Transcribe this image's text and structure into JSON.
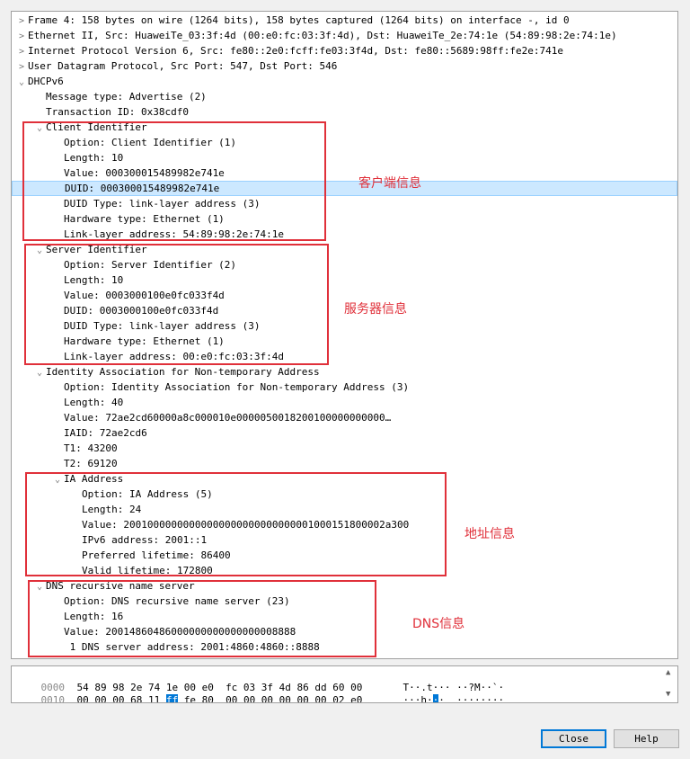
{
  "tree": {
    "rows": [
      {
        "arrow": ">",
        "text": "Frame 4: 158 bytes on wire (1264 bits), 158 bytes captured (1264 bits) on interface -, id 0"
      },
      {
        "arrow": ">",
        "text": "Ethernet II, Src: HuaweiTe_03:3f:4d (00:e0:fc:03:3f:4d), Dst: HuaweiTe_2e:74:1e (54:89:98:2e:74:1e)"
      },
      {
        "arrow": ">",
        "text": "Internet Protocol Version 6, Src: fe80::2e0:fcff:fe03:3f4d, Dst: fe80::5689:98ff:fe2e:741e"
      },
      {
        "arrow": ">",
        "text": "User Datagram Protocol, Src Port: 547, Dst Port: 546"
      },
      {
        "arrow": "⌄",
        "text": "DHCPv6"
      },
      {
        "arrow": "",
        "text": "Message type: Advertise (2)"
      },
      {
        "arrow": "",
        "text": "Transaction ID: 0x38cdf0"
      },
      {
        "arrow": "⌄",
        "text": "Client Identifier"
      },
      {
        "arrow": "",
        "text": "Option: Client Identifier (1)"
      },
      {
        "arrow": "",
        "text": "Length: 10"
      },
      {
        "arrow": "",
        "text": "Value: 000300015489982e741e"
      },
      {
        "arrow": "",
        "text": "DUID: 000300015489982e741e"
      },
      {
        "arrow": "",
        "text": "DUID Type: link-layer address (3)"
      },
      {
        "arrow": "",
        "text": "Hardware type: Ethernet (1)"
      },
      {
        "arrow": "",
        "text": "Link-layer address: 54:89:98:2e:74:1e"
      },
      {
        "arrow": "⌄",
        "text": "Server Identifier"
      },
      {
        "arrow": "",
        "text": "Option: Server Identifier (2)"
      },
      {
        "arrow": "",
        "text": "Length: 10"
      },
      {
        "arrow": "",
        "text": "Value: 0003000100e0fc033f4d"
      },
      {
        "arrow": "",
        "text": "DUID: 0003000100e0fc033f4d"
      },
      {
        "arrow": "",
        "text": "DUID Type: link-layer address (3)"
      },
      {
        "arrow": "",
        "text": "Hardware type: Ethernet (1)"
      },
      {
        "arrow": "",
        "text": "Link-layer address: 00:e0:fc:03:3f:4d"
      },
      {
        "arrow": "⌄",
        "text": "Identity Association for Non-temporary Address"
      },
      {
        "arrow": "",
        "text": "Option: Identity Association for Non-temporary Address (3)"
      },
      {
        "arrow": "",
        "text": "Length: 40"
      },
      {
        "arrow": "",
        "text": "Value: 72ae2cd60000a8c000010e0000050018200100000000000…"
      },
      {
        "arrow": "",
        "text": "IAID: 72ae2cd6"
      },
      {
        "arrow": "",
        "text": "T1: 43200"
      },
      {
        "arrow": "",
        "text": "T2: 69120"
      },
      {
        "arrow": "⌄",
        "text": "IA Address"
      },
      {
        "arrow": "",
        "text": "Option: IA Address (5)"
      },
      {
        "arrow": "",
        "text": "Length: 24"
      },
      {
        "arrow": "",
        "text": "Value: 20010000000000000000000000000001000151800002a300"
      },
      {
        "arrow": "",
        "text": "IPv6 address: 2001::1"
      },
      {
        "arrow": "",
        "text": "Preferred lifetime: 86400"
      },
      {
        "arrow": "",
        "text": "Valid lifetime: 172800"
      },
      {
        "arrow": "⌄",
        "text": "DNS recursive name server"
      },
      {
        "arrow": "",
        "text": "Option: DNS recursive name server (23)"
      },
      {
        "arrow": "",
        "text": "Length: 16"
      },
      {
        "arrow": "",
        "text": "Value: 20014860486000000000000000008888"
      },
      {
        "arrow": "",
        "text": " 1 DNS server address: 2001:4860:4860::8888"
      }
    ],
    "selected_row_text": "DUID: 000300015489982e741e"
  },
  "annotations": {
    "client": "客户端信息",
    "server": "服务器信息",
    "address": "地址信息",
    "dns": "DNS信息",
    "color": "#e0303a"
  },
  "hex": {
    "row0": {
      "offset": "0000",
      "bytes": "54 89 98 2e 74 1e 00 e0  fc 03 3f 4d 86 dd 60 00",
      "ascii": "T··.t··· ··?M··`·"
    },
    "row1": {
      "offset": "0010",
      "bytes_pre": "00 00 00 68 11 ",
      "bytes_hl": "ff",
      "bytes_post": " fe 80  00 00 00 00 00 00 02 e0",
      "ascii_pre": "···h·",
      "ascii_hl": "·",
      "ascii_post": "·  ········"
    }
  },
  "buttons": {
    "close": "Close",
    "help": "Help"
  },
  "colors": {
    "selection": "#cce8ff",
    "hex_highlight": "#0078d7",
    "default_button_border": "#0078d7"
  }
}
